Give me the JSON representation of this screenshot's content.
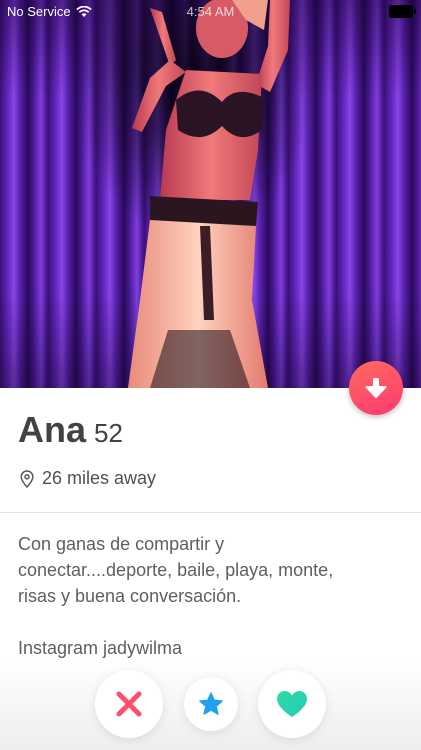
{
  "status_bar": {
    "carrier": "No Service",
    "time": "4:54 AM"
  },
  "profile": {
    "name": "Ana",
    "age": "52",
    "distance": "26 miles away",
    "bio": "Con ganas de compartir y\nconectar....deporte, baile, playa, monte,\nrisas y buena conversación.",
    "instagram": "Instagram jadywilma"
  },
  "icons": {
    "status": [
      "wifi-icon",
      "battery-icon"
    ],
    "collapse": "arrow-down-icon",
    "distance": "location-pin-icon",
    "actions": [
      "close-icon",
      "star-icon",
      "heart-icon"
    ]
  },
  "colors": {
    "accent_gradient_start": "#ff6a5b",
    "accent_gradient_end": "#fd3a73",
    "nope": "#fd5068",
    "super_like": "#1ea1f1",
    "like": "#2ddca6",
    "text_primary": "#424242",
    "text_secondary": "#5f5f5f"
  }
}
